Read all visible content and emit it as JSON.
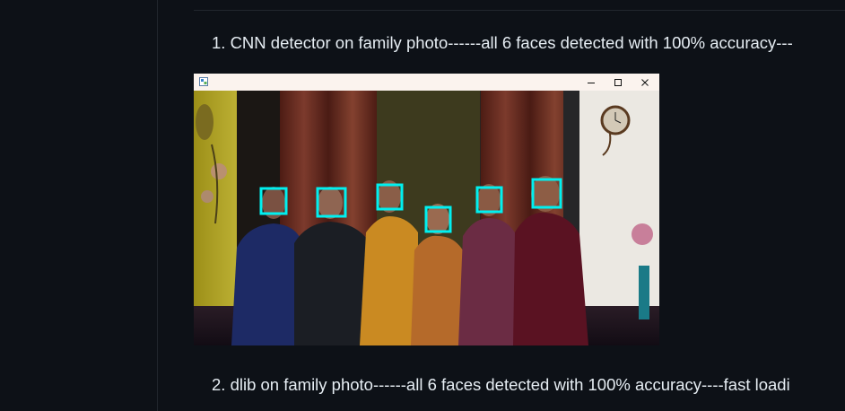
{
  "content": {
    "item1": "1. CNN detector on family photo------all 6 faces detected with 100% accuracy---",
    "item2": "2. dlib on family photo------all 6 faces detected with 100% accuracy----fast loadi"
  },
  "window": {
    "title": "",
    "controls": [
      "minimize-icon",
      "maximize-icon",
      "close-icon"
    ],
    "detection_box_color": "#00f0f0"
  }
}
